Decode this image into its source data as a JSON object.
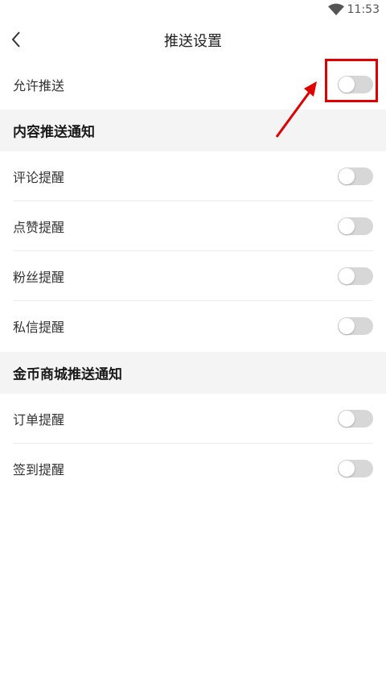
{
  "status_bar": {
    "time": "11:53"
  },
  "header": {
    "title": "推送设置"
  },
  "allow_push": {
    "label": "允许推送",
    "enabled": false
  },
  "sections": [
    {
      "title": "内容推送通知",
      "items": [
        {
          "label": "评论提醒",
          "enabled": false
        },
        {
          "label": "点赞提醒",
          "enabled": false
        },
        {
          "label": "粉丝提醒",
          "enabled": false
        },
        {
          "label": "私信提醒",
          "enabled": false
        }
      ]
    },
    {
      "title": "金币商城推送通知",
      "items": [
        {
          "label": "订单提醒",
          "enabled": false
        },
        {
          "label": "签到提醒",
          "enabled": false
        }
      ]
    }
  ],
  "annotation": {
    "color": "#e00000"
  },
  "colors": {
    "toggle_off": "#d7d7d7",
    "section_bg": "#f4f4f4"
  }
}
